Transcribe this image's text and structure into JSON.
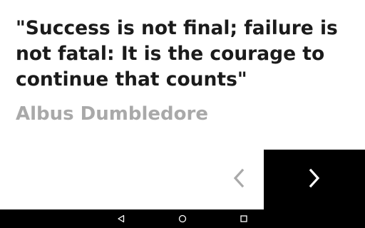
{
  "quote": {
    "text": "\"Success is not final; failure is not fatal: It is the courage to continue that counts\"",
    "author": "Albus Dumbledore"
  },
  "navigation": {
    "prev_icon": "chevron-left-icon",
    "next_icon": "chevron-right-icon",
    "prev_color": "#a9a9a9",
    "next_color": "#ffffff",
    "next_background": "#000000"
  },
  "system_nav": {
    "back_icon": "triangle-back-icon",
    "home_icon": "circle-home-icon",
    "recents_icon": "square-recents-icon",
    "background": "#000000"
  },
  "colors": {
    "quote_text": "#1b1b1b",
    "author_text": "#a9a9a9",
    "background": "#ffffff"
  }
}
